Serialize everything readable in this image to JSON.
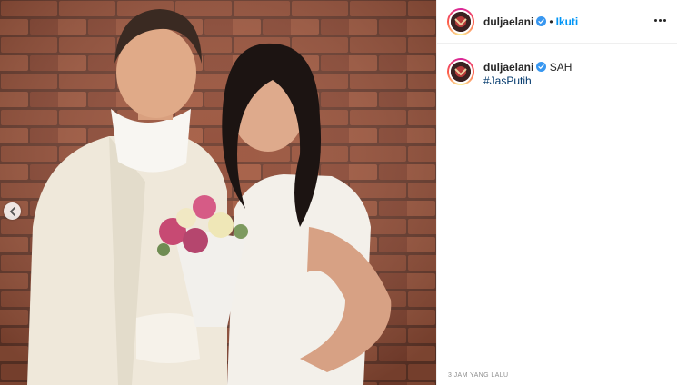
{
  "post": {
    "username": "duljaelani",
    "follow_label": "Ikuti",
    "separator": "•",
    "caption_text": "SAH",
    "hashtag": "#JasPutih",
    "timestamp": "3 JAM YANG LALU"
  },
  "icons": {
    "verified": "verified-badge-icon",
    "more": "more-options-icon",
    "previous": "chevron-left-icon"
  },
  "colors": {
    "link_blue": "#0095f6",
    "hashtag_blue": "#00376b",
    "verified_blue": "#3897f0",
    "text": "#262626",
    "muted": "#8e8e8e"
  }
}
